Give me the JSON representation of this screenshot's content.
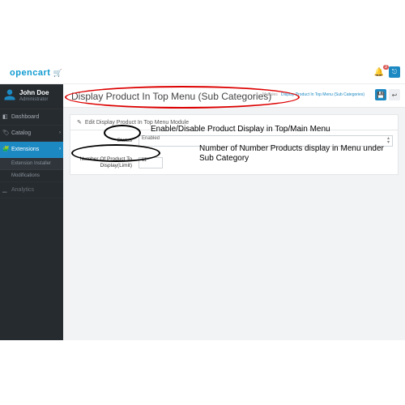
{
  "logo_text": "opencart",
  "topbar": {
    "bell_count": "3"
  },
  "user": {
    "name": "John Doe",
    "role": "Administrator"
  },
  "sidebar": {
    "items": [
      {
        "label": "Dashboard"
      },
      {
        "label": "Catalog"
      },
      {
        "label": "Extensions"
      },
      {
        "label": "Analytics"
      }
    ],
    "sub": [
      {
        "label": "Extension Installer"
      },
      {
        "label": "Modifications"
      }
    ]
  },
  "breadcrumb": {
    "b1": "Home",
    "b2": "Modules",
    "b3": "Display Product In Top Menu (Sub Categories)"
  },
  "page_title": "Display Product In Top Menu (Sub Categories)",
  "panel_title": "Edit Display Product In Top Menu Module",
  "form": {
    "status_label": "Status",
    "status_value": "Enabled",
    "limit_label": "Number Of Product To Display(Limit)",
    "limit_value": "11"
  },
  "annotations": {
    "a1": "Enable/Disable Product Display in Top/Main Menu",
    "a2": "Number of Number Products display in Menu under Sub Category"
  }
}
